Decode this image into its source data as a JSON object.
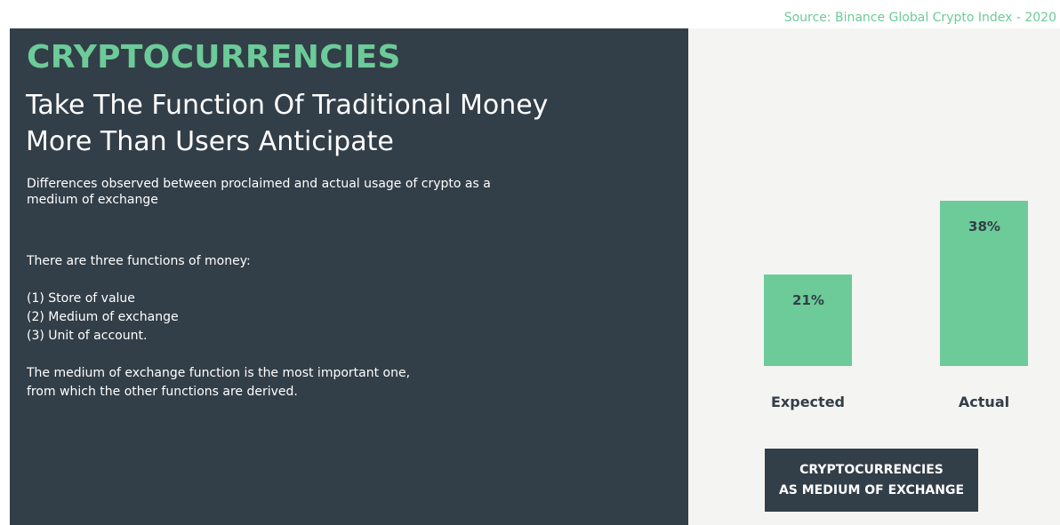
{
  "source": "Source: Binance Global Crypto Index - 2020",
  "title": "CRYPTOCURRENCIES",
  "subtitle": "Take The Function Of Traditional Money More Than Users Anticipate",
  "description": "Differences observed between proclaimed and actual usage of crypto as a medium of exchange",
  "functions": {
    "intro": "There are three functions of money:",
    "items": [
      "(1) Store of value",
      "(2) Medium of exchange",
      "(3) Unit of account."
    ],
    "conclusion_line1": "The medium of exchange function is the most important one,",
    "conclusion_line2": "from which the other functions are derived."
  },
  "chart_data": {
    "type": "bar",
    "categories": [
      "Expected",
      "Actual"
    ],
    "values": [
      21,
      38
    ],
    "value_labels": [
      "21%",
      "38%"
    ],
    "unit": "%",
    "caption_line1": "CRYPTOCURRENCIES",
    "caption_line2": "AS MEDIUM OF EXCHANGE"
  },
  "colors": {
    "accent": "#6ccb98",
    "dark": "#323e48",
    "panel_light": "#f4f4f2"
  }
}
